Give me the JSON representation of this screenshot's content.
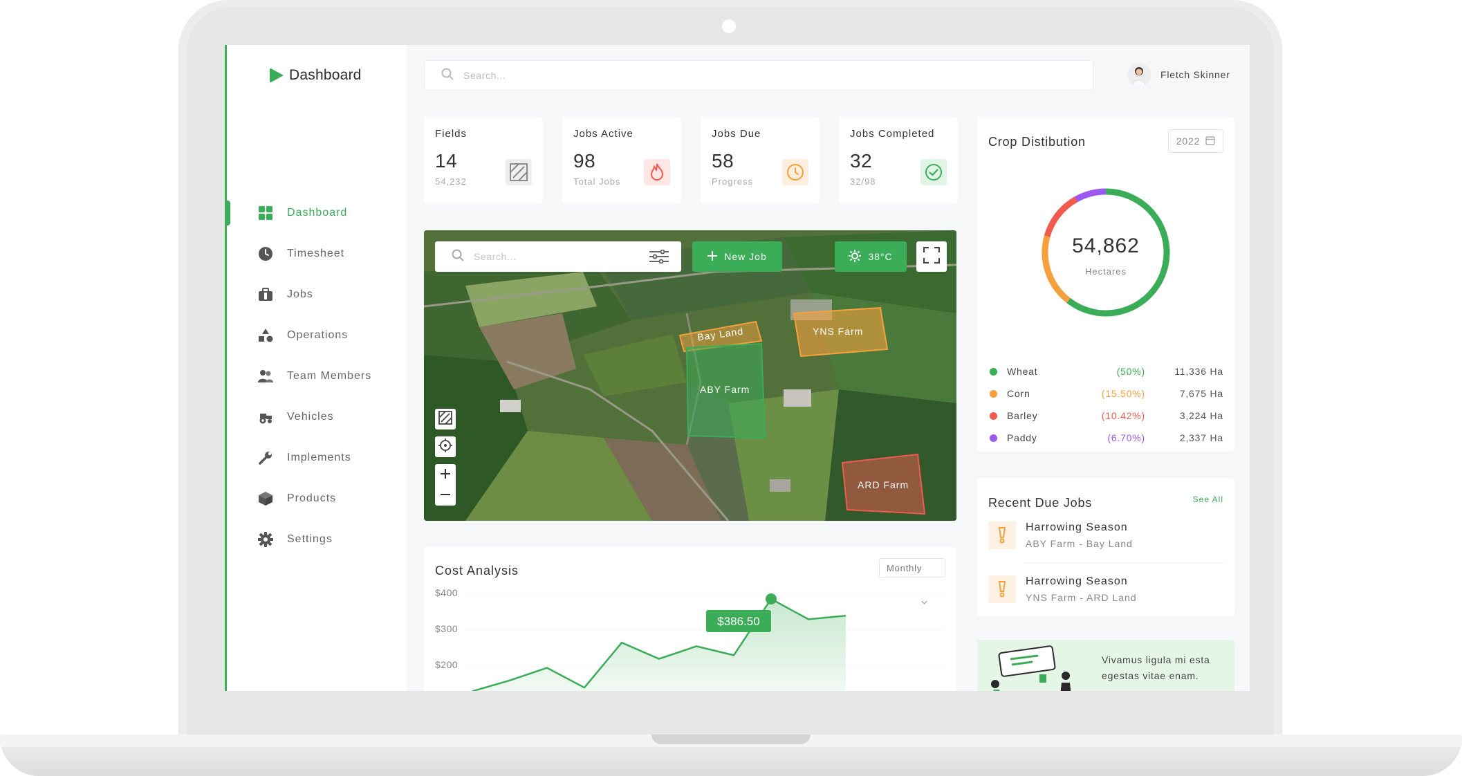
{
  "brand": {
    "name": "Dashboard",
    "color": "#3bac57"
  },
  "search": {
    "placeholder": "Search..."
  },
  "user": {
    "name": "Fletch Skinner"
  },
  "nav": [
    {
      "label": "Dashboard",
      "icon": "grid-icon",
      "active": true
    },
    {
      "label": "Timesheet",
      "icon": "clock-icon"
    },
    {
      "label": "Jobs",
      "icon": "briefcase-icon"
    },
    {
      "label": "Operations",
      "icon": "shapes-icon"
    },
    {
      "label": "Team Members",
      "icon": "users-icon"
    },
    {
      "label": "Vehicles",
      "icon": "tractor-icon"
    },
    {
      "label": "Implements",
      "icon": "wrench-icon"
    },
    {
      "label": "Products",
      "icon": "box-icon"
    },
    {
      "label": "Settings",
      "icon": "gear-icon"
    }
  ],
  "stats": [
    {
      "title": "Fields",
      "value": "14",
      "sub": "54,232",
      "icon": "field-pattern-icon",
      "color": "#9a9a9a"
    },
    {
      "title": "Jobs Active",
      "value": "98",
      "sub": "Total Jobs",
      "icon": "flame-icon",
      "color": "#f05a4f"
    },
    {
      "title": "Jobs Due",
      "value": "58",
      "sub": "Progress",
      "icon": "clock-icon",
      "color": "#f5a03c"
    },
    {
      "title": "Jobs Completed",
      "value": "32",
      "sub": "32/98",
      "icon": "check-circle-icon",
      "color": "#3bac57"
    }
  ],
  "map": {
    "search_placeholder": "Search...",
    "new_job_label": "New Job",
    "weather": "38°C",
    "fields": [
      {
        "name": "Bay Land",
        "color": "#f5a03c"
      },
      {
        "name": "YNS Farm",
        "color": "#f5a03c"
      },
      {
        "name": "ABY Farm",
        "color": "#3bac57"
      },
      {
        "name": "ARD Farm",
        "color": "#f05a4f"
      }
    ]
  },
  "cost": {
    "title": "Cost Analysis",
    "period": "Monthly",
    "tooltip": "$386.50",
    "y_ticks": [
      "$400",
      "$300",
      "$200"
    ]
  },
  "chart_data": {
    "type": "area",
    "title": "Cost Analysis",
    "ylabel": "",
    "ylim": [
      120,
      420
    ],
    "y_ticks": [
      200,
      300,
      400
    ],
    "values": [
      130,
      160,
      195,
      140,
      265,
      220,
      255,
      230,
      386.5,
      330,
      340
    ],
    "highlight_index": 8,
    "highlight_label": "$386.50",
    "color": "#3bac57"
  },
  "crop": {
    "title": "Crop Distibution",
    "year": "2022",
    "total": "54,862",
    "unit": "Hectares",
    "items": [
      {
        "name": "Wheat",
        "pct": "(50%)",
        "value": "11,336 Ha",
        "color": "#3bac57",
        "share": 50
      },
      {
        "name": "Corn",
        "pct": "(15.50%)",
        "value": "7,675 Ha",
        "color": "#f5a03c",
        "share": 15.5
      },
      {
        "name": "Barley",
        "pct": "(10.42%)",
        "value": "3,224 Ha",
        "color": "#f05a4f",
        "share": 10.42
      },
      {
        "name": "Paddy",
        "pct": "(6.70%)",
        "value": "2,337 Ha",
        "color": "#9b59f0",
        "share": 6.7
      }
    ]
  },
  "recent": {
    "title": "Recent Due Jobs",
    "see_all": "See All",
    "jobs": [
      {
        "title": "Harrowing Season",
        "sub": "ABY Farm - Bay Land"
      },
      {
        "title": "Harrowing Season",
        "sub": "YNS Farm - ARD Land"
      }
    ]
  },
  "promo": {
    "text": "Vivamus ligula mi esta egestas vitae enam."
  }
}
